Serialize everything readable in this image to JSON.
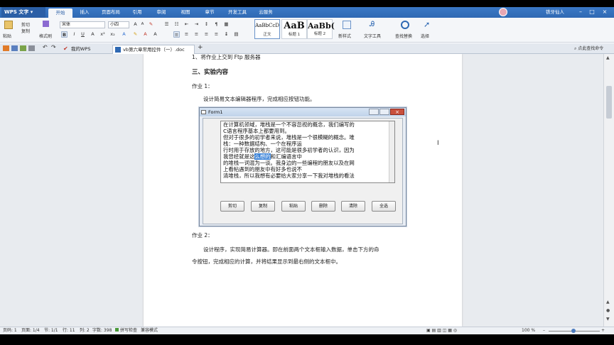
{
  "app": {
    "title": "WPS 文字"
  },
  "menu": [
    "开始",
    "插入",
    "页面布局",
    "引用",
    "审阅",
    "视图",
    "章节",
    "开发工具",
    "云服务"
  ],
  "user": {
    "name": "铁牙仙人"
  },
  "toolbar": {
    "paste": "粘贴",
    "cut": "剪切",
    "copy": "复制",
    "format_painter": "格式刷",
    "font": "宋体",
    "size": "小四",
    "styles": [
      {
        "sample": "AaBbCcD",
        "label": "正文"
      },
      {
        "sample": "AaB",
        "label": "标题 1"
      },
      {
        "sample": "AaBb(",
        "label": "标题 2"
      }
    ],
    "new_style": "新样式",
    "text_tools": "文字工具",
    "find_replace": "查找替换",
    "select": "选择"
  },
  "tabs": {
    "home": "我的WPS",
    "doc": "vb第六章常用控件（一）.doc",
    "search": "点此查找命令"
  },
  "document": {
    "line1": "1、将作业上交到 Ftp 服务器",
    "heading": "三、实验内容",
    "hw1": "作业 1：",
    "hw1_desc": "设计简易文本编辑器程序，完成相应按钮功能。",
    "hw2": "作业 2：",
    "hw2_desc1": "设计程序，实现简易计算器。即在前面两个文本框输入数据，单击下方的命",
    "hw2_desc2": "令按钮，完成相应的计算，并将结果显示到最右侧的文本框中。"
  },
  "form": {
    "title": "Form1",
    "lines": [
      "在计算机领域，堆栈是一个不容忽视的概念，我们编写的",
      "C语言程序基本上都要用到。",
      "但对于很多的初学者来说，堆栈是一个很模糊的概念。堆",
      "栈：一种数据结构、一个在程序运",
      "行时用于存放的地方，这可能是很多初学者的认识，因为",
      "我曾经就是这么想的和汇编语言中",
      "的堆栈一词混为一谈。我身边的一些编程的朋友以及在网",
      "上看帖遇到的朋友中有好多也说不",
      "清堆栈，所以我想有必要给大家分享一下我对堆栈的看法"
    ],
    "line6_pre": "我曾经就是这",
    "line6_sel": "么想的",
    "line6_post": "和汇编语言中",
    "buttons": [
      "剪切",
      "复制",
      "粘贴",
      "删除",
      "清除",
      "全选"
    ]
  },
  "status": {
    "line": "页码: 1",
    "page": "页面: 1/4",
    "section": "节: 1/1",
    "row": "行: 11",
    "col": "列: 2",
    "words": "字数: 398",
    "spell": "拼写检查",
    "mode": "兼容模式",
    "zoom": "100 %"
  }
}
